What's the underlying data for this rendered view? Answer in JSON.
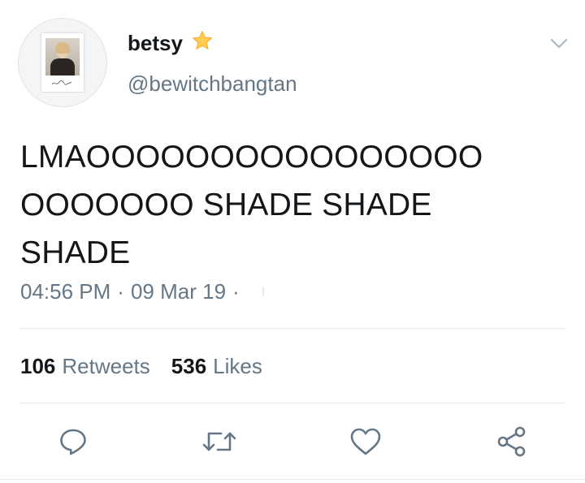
{
  "user": {
    "display_name": "betsy",
    "handle": "@bewitchbangtan",
    "name_emoji_icon": "star-icon",
    "avatar_icon": "polaroid-photo-avatar"
  },
  "tweet": {
    "lines": [
      "LMAOOOOOOOOOOOOOOOO",
      "OOOOOOO SHADE SHADE",
      "SHADE"
    ],
    "time": "04:56 PM",
    "separator": "·",
    "date": "09 Mar 19",
    "trailing_separator": "·"
  },
  "stats": {
    "retweets_count": "106",
    "retweets_label": "Retweets",
    "likes_count": "536",
    "likes_label": "Likes"
  },
  "actions": [
    {
      "icon": "reply-icon"
    },
    {
      "icon": "retweet-icon"
    },
    {
      "icon": "like-icon"
    },
    {
      "icon": "share-icon"
    }
  ],
  "colors": {
    "text_primary": "#14171a",
    "text_secondary": "#657786",
    "icon_gray": "#657786",
    "divider": "#e1e8ed",
    "star": "#ffcc4d"
  }
}
